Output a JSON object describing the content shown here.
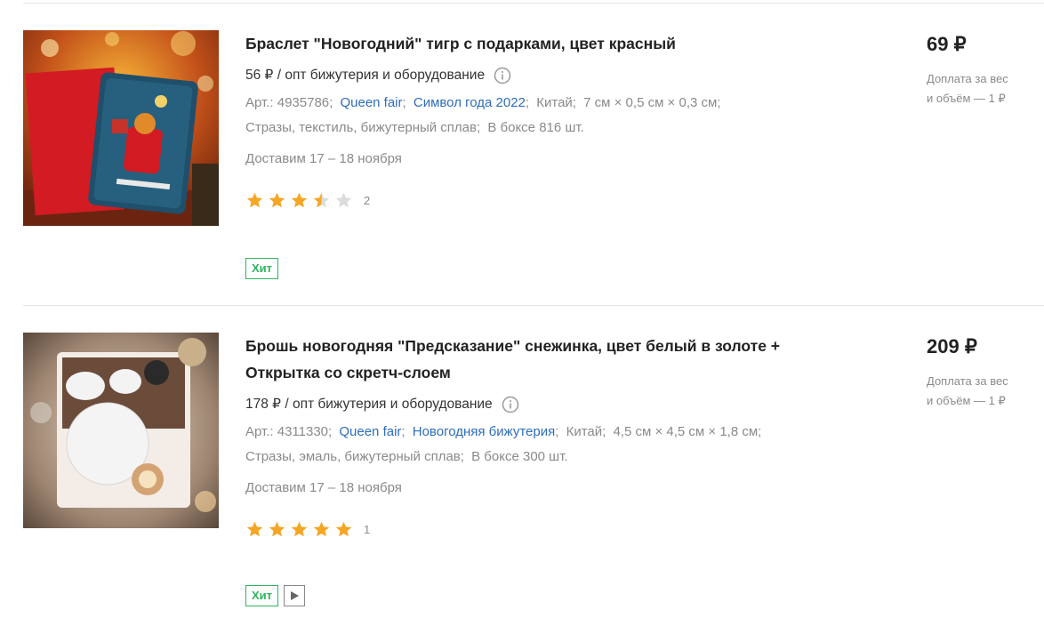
{
  "products": [
    {
      "title": "Браслет \"Новогодний\" тигр с подарками, цвет красный",
      "title_line2": "",
      "wholesale_price": "56 ₽",
      "wholesale_label": "/ опт бижутерия и оборудование",
      "article": "Арт.: 4935786",
      "brand": "Queen fair",
      "collection": "Символ года 2022",
      "country": "Китай",
      "dimensions": "7 см × 0,5 см × 0,3 см",
      "materials": "Стразы, текстиль, бижутерный сплав",
      "box": "В боксе 816 шт.",
      "delivery": "Доставим 17 – 18 ноября",
      "rating": 3.5,
      "reviews_count": "2",
      "badges": [
        "Хит"
      ],
      "has_video": false,
      "price": "69 ₽",
      "extra_line1": "Доплата за вес",
      "extra_line2": "и объём — 1 ₽"
    },
    {
      "title": "Брошь новогодняя \"Предсказание\" снежинка, цвет белый в золоте +",
      "title_line2": "Открытка со скретч-слоем",
      "wholesale_price": "178 ₽",
      "wholesale_label": "/ опт бижутерия и оборудование",
      "article": "Арт.: 4311330",
      "brand": "Queen fair",
      "collection": "Новогодняя бижутерия",
      "country": "Китай",
      "dimensions": "4,5 см × 4,5 см × 1,8 см",
      "materials": "Стразы, эмаль, бижутерный сплав",
      "box": "В боксе 300 шт.",
      "delivery": "Доставим 17 – 18 ноября",
      "rating": 5,
      "reviews_count": "1",
      "badges": [
        "Хит"
      ],
      "has_video": true,
      "price": "209 ₽",
      "extra_line1": "Доплата за вес",
      "extra_line2": "и объём — 1 ₽"
    }
  ],
  "colors": {
    "link": "#2d6dbd",
    "hit_badge": "#2db55d",
    "star": "#f5a623",
    "star_empty": "#dcdcdc",
    "muted": "#8a8a8a"
  },
  "icons": {
    "info": "info-circle-icon",
    "star": "star-icon",
    "play": "play-icon"
  }
}
